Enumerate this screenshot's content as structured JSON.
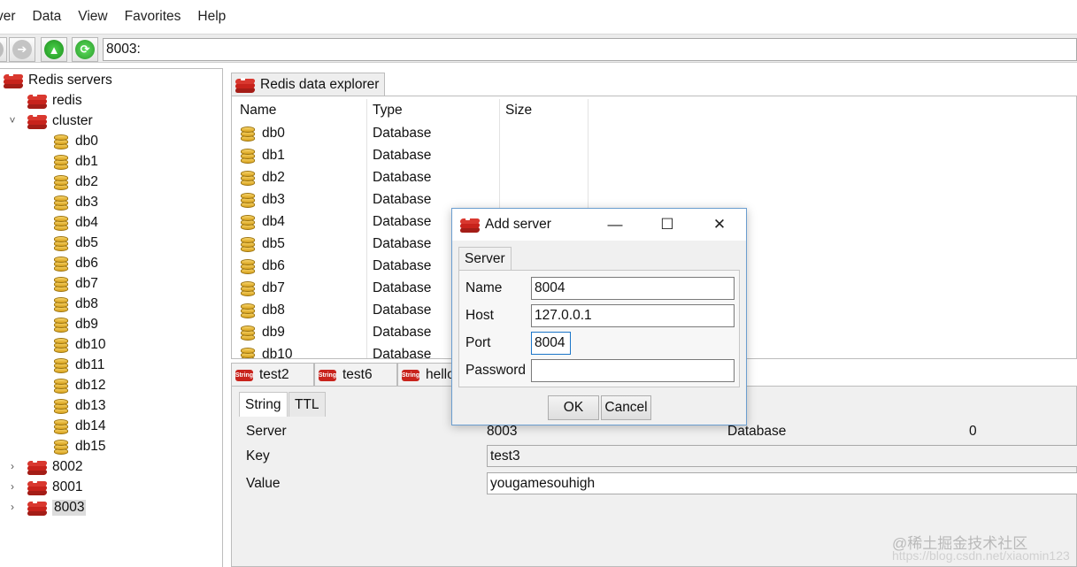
{
  "menu": [
    "ver",
    "Data",
    "View",
    "Favorites",
    "Help"
  ],
  "toolbar": {
    "buttons": [
      "back-button",
      "forward-button",
      "up-button",
      "refresh-button"
    ],
    "address": "8003:"
  },
  "tree": {
    "root": "Redis servers",
    "servers": [
      "redis",
      "cluster",
      "8002",
      "8001",
      "8003"
    ],
    "databases": [
      "db0",
      "db1",
      "db2",
      "db3",
      "db4",
      "db5",
      "db6",
      "db7",
      "db8",
      "db9",
      "db10",
      "db11",
      "db12",
      "db13",
      "db14",
      "db15"
    ]
  },
  "explorer": {
    "tab": "Redis data explorer",
    "columns": [
      "Name",
      "Type",
      "Size"
    ],
    "rows": [
      {
        "name": "db0",
        "type": "Database"
      },
      {
        "name": "db1",
        "type": "Database"
      },
      {
        "name": "db2",
        "type": "Database"
      },
      {
        "name": "db3",
        "type": "Database"
      },
      {
        "name": "db4",
        "type": "Database"
      },
      {
        "name": "db5",
        "type": "Database"
      },
      {
        "name": "db6",
        "type": "Database"
      },
      {
        "name": "db7",
        "type": "Database"
      },
      {
        "name": "db8",
        "type": "Database"
      },
      {
        "name": "db9",
        "type": "Database"
      },
      {
        "name": "db10",
        "type": "Database"
      }
    ]
  },
  "key_tabs": {
    "icon_text": "String",
    "tabs": [
      "test2",
      "test6",
      "hello"
    ]
  },
  "key_panel": {
    "subtabs": [
      "String",
      "TTL"
    ],
    "server_label": "Server",
    "server_value": "8003",
    "database_label": "Database",
    "database_value": "0",
    "key_label": "Key",
    "key_value": "test3",
    "value_label": "Value",
    "value_value": "yougamesouhigh"
  },
  "dialog": {
    "title": "Add server",
    "tab": "Server",
    "name_label": "Name",
    "name_value": "8004",
    "host_label": "Host",
    "host_value": "127.0.0.1",
    "port_label": "Port",
    "port_value": "8004",
    "password_label": "Password",
    "password_value": "",
    "ok": "OK",
    "cancel": "Cancel",
    "minimize": "—",
    "maximize": "☐",
    "close": "✕"
  },
  "watermark": "@稀土掘金技术社区",
  "watermark_url": "https://blog.csdn.net/xiaomin123"
}
